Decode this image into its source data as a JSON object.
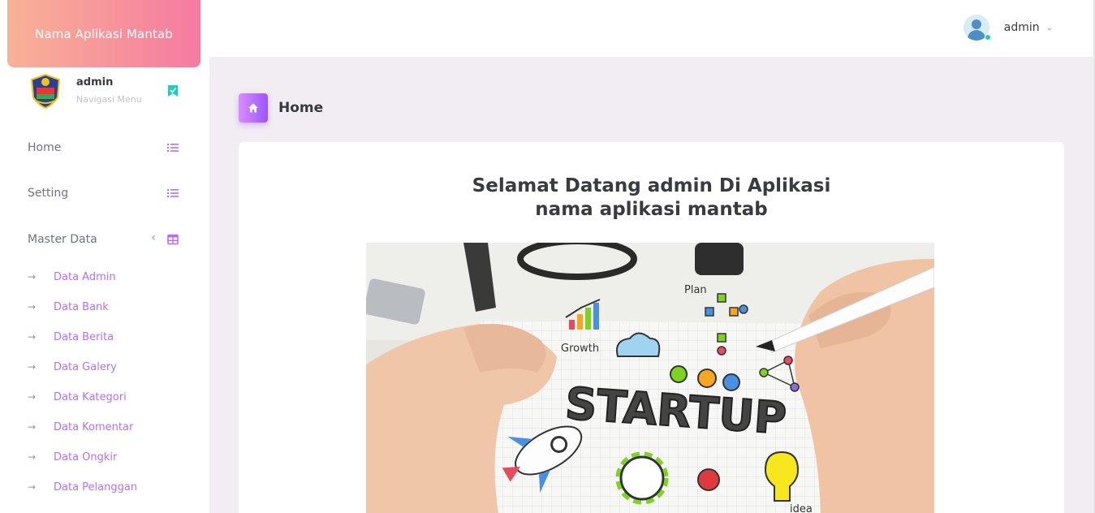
{
  "app": {
    "brand": "Nama Aplikasi Mantab"
  },
  "topbar": {
    "user_name": "admin"
  },
  "sidebar": {
    "profile": {
      "name": "admin",
      "subtitle": "Navigasi Menu"
    },
    "menu": [
      {
        "label": "Home"
      },
      {
        "label": "Setting"
      },
      {
        "label": "Master Data"
      }
    ],
    "submenu": [
      {
        "label": "Data Admin"
      },
      {
        "label": "Data Bank"
      },
      {
        "label": "Data Berita"
      },
      {
        "label": "Data Galery"
      },
      {
        "label": "Data Kategori"
      },
      {
        "label": "Data Komentar"
      },
      {
        "label": "Data Ongkir"
      },
      {
        "label": "Data Pelanggan"
      }
    ]
  },
  "main": {
    "page_title": "Home",
    "welcome_line1": "Selamat Datang admin Di Aplikasi",
    "welcome_line2": "nama aplikasi mantab",
    "hero_image": {
      "word": "STARTUP",
      "labels": [
        "Plan",
        "Growth",
        "idea"
      ]
    }
  },
  "colors": {
    "accent": "#b66dff",
    "brand_from": "#f8b296",
    "brand_to": "#f67aa0",
    "online": "#1bcfb4"
  }
}
